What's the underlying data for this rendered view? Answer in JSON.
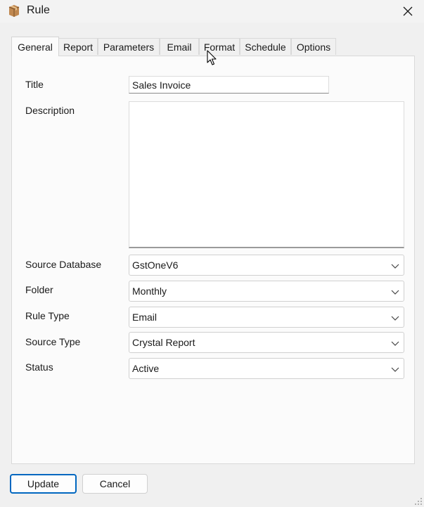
{
  "window": {
    "title": "Rule"
  },
  "tabs": [
    {
      "label": "General"
    },
    {
      "label": "Report"
    },
    {
      "label": "Parameters"
    },
    {
      "label": "Email"
    },
    {
      "label": "Format"
    },
    {
      "label": "Schedule"
    },
    {
      "label": "Options"
    }
  ],
  "form": {
    "title_label": "Title",
    "title_value": "Sales Invoice",
    "description_label": "Description",
    "description_value": "",
    "source_database_label": "Source Database",
    "source_database_value": "GstOneV6",
    "folder_label": "Folder",
    "folder_value": "Monthly",
    "rule_type_label": "Rule Type",
    "rule_type_value": "Email",
    "source_type_label": "Source Type",
    "source_type_value": "Crystal Report",
    "status_label": "Status",
    "status_value": "Active"
  },
  "buttons": {
    "update": "Update",
    "cancel": "Cancel"
  },
  "colors": {
    "primary_border": "#0067c0",
    "panel_bg": "#fbfbfb",
    "window_bg": "#f0f0f0"
  },
  "icons": {
    "app": "package-box-icon",
    "close": "close-icon",
    "dropdown": "chevron-down-icon",
    "cursor": "mouse-pointer-icon"
  }
}
